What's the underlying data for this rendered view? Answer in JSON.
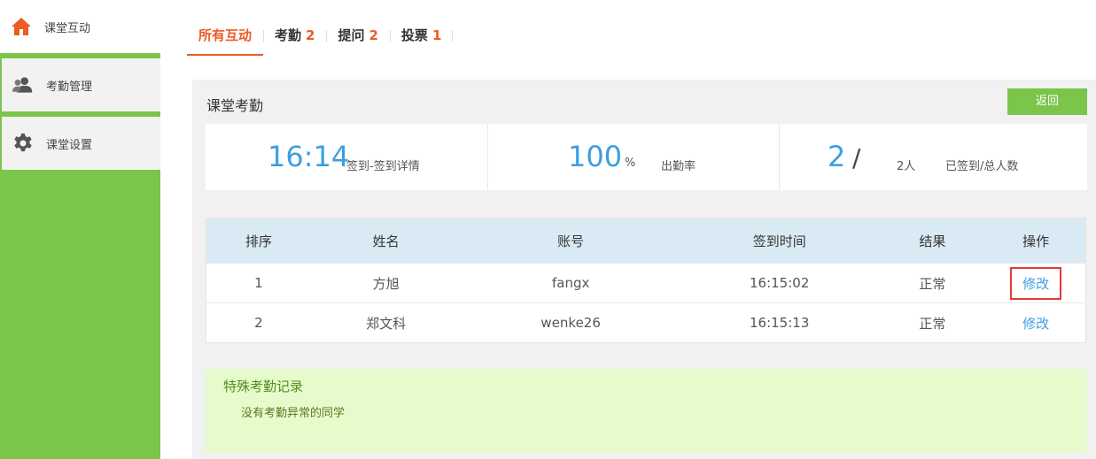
{
  "sidebar": {
    "items": [
      {
        "label": "课堂互动",
        "icon": "home-icon"
      },
      {
        "label": "考勤管理",
        "icon": "users-icon"
      },
      {
        "label": "课堂设置",
        "icon": "gear-icon"
      }
    ]
  },
  "tabs": [
    {
      "label": "所有互动",
      "count": ""
    },
    {
      "label": "考勤",
      "count": "2"
    },
    {
      "label": "提问",
      "count": "2"
    },
    {
      "label": "投票",
      "count": "1"
    }
  ],
  "panel": {
    "title": "课堂考勤",
    "back_label": "返回"
  },
  "stats": {
    "time": "16:14",
    "time_label": "签到-签到详情",
    "rate": "100",
    "rate_unit": "%",
    "rate_label": "出勤率",
    "signed": "2",
    "slash": "/",
    "total": "2人",
    "count_label": "已签到/总人数"
  },
  "table": {
    "headers": [
      "排序",
      "姓名",
      "账号",
      "签到时间",
      "结果",
      "操作"
    ],
    "rows": [
      {
        "index": "1",
        "name": "方旭",
        "account": "fangx",
        "time": "16:15:02",
        "result": "正常",
        "action": "修改"
      },
      {
        "index": "2",
        "name": "郑文科",
        "account": "wenke26",
        "time": "16:15:13",
        "result": "正常",
        "action": "修改"
      }
    ]
  },
  "special": {
    "title": "特殊考勤记录",
    "text": "没有考勤异常的同学"
  },
  "colors": {
    "accent_green": "#7bc54a",
    "accent_orange": "#ee5a24",
    "link_blue": "#3c9fe0",
    "highlight_red": "#e53935"
  }
}
